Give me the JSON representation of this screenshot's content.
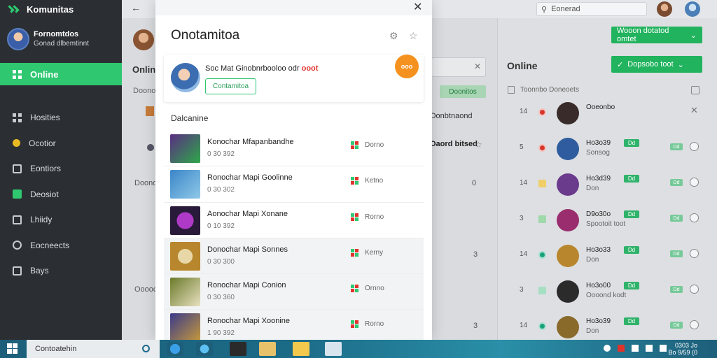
{
  "app": {
    "name": "Komunitas"
  },
  "profile": {
    "name": "Fornomtdos",
    "subtitle": "Gonad dlbemtinnt"
  },
  "nav": {
    "active": "Online",
    "items": [
      {
        "label": "Hosities",
        "icon": "grid-icon"
      },
      {
        "label": "Ocotior",
        "icon": "coin-icon"
      },
      {
        "label": "Eontiors",
        "icon": "puzzle-icon"
      },
      {
        "label": "Deosiot",
        "icon": "trophy-icon"
      },
      {
        "label": "Lhiidy",
        "icon": "card-icon"
      },
      {
        "label": "Eocneects",
        "icon": "connect-icon"
      },
      {
        "label": "Bays",
        "icon": "store-icon"
      }
    ]
  },
  "topbar": {
    "search_placeholder": "Eonerad"
  },
  "background_panel": {
    "title": "Onlin",
    "subhead": "Doonoo",
    "button": "Doonitos",
    "label1": "Oonbtnaond",
    "label2": "Oaord bitsed",
    "numbers": [
      "Doonod",
      "0",
      "Ooooc",
      "3",
      "3"
    ]
  },
  "right_panel": {
    "title": "Online",
    "button1": "Wooon dotatod omtet",
    "button2": "Dopsobo toot",
    "header": "Toonnbo Doneoets",
    "rows": [
      {
        "num": "14",
        "status": "red",
        "name": "Ooeonbo",
        "sub": "",
        "badge": "",
        "pill": "",
        "thumb": "#3a2b2b",
        "end": "x"
      },
      {
        "num": "5",
        "status": "red",
        "name": "Ho3o39",
        "sub": "Sonsog",
        "badge": "Dd",
        "pill": "Dd",
        "thumb": "#2e5c9e",
        "end": "radio"
      },
      {
        "num": "14",
        "status": "yellow",
        "name": "Ho3d39",
        "sub": "Don",
        "badge": "Dd",
        "pill": "Dd",
        "thumb": "#6a3a8c",
        "end": "radio"
      },
      {
        "num": "3",
        "status": "lgreen",
        "name": "D9o30o",
        "sub": "Spootoit toot",
        "badge": "Dd",
        "pill": "Dd",
        "thumb": "#9a2d6e",
        "end": "radio"
      },
      {
        "num": "14",
        "status": "teal",
        "name": "Ho3o33",
        "sub": "Don",
        "badge": "Dd",
        "pill": "Dd",
        "thumb": "#b8862c",
        "end": "radio"
      },
      {
        "num": "3",
        "status": "mint",
        "name": "Ho3o00",
        "sub": "Oooond kodt",
        "badge": "Dd",
        "pill": "Dd",
        "thumb": "#2b2b2b",
        "end": "radio"
      },
      {
        "num": "14",
        "status": "teal",
        "name": "Ho3o39",
        "sub": "Don",
        "badge": "Dd",
        "pill": "Dd",
        "thumb": "#8a6a2a",
        "end": "radio"
      }
    ]
  },
  "modal": {
    "title": "Onotamitoa",
    "profile_text": "Soc Mat Ginobnrbooloo odr",
    "profile_highlight": "ooot",
    "profile_button": "Contamitoa",
    "orange_badge": "ooo",
    "section_label": "Dalcanine",
    "games": [
      {
        "title": "Konochar Mfapanbandhe",
        "meta": "0 30 392",
        "status": "Dorno",
        "c1": "#5a2d82",
        "c2": "#2ea84a"
      },
      {
        "title": "Ronochar Mapi Goolinne",
        "meta": "0 30 302",
        "status": "Ketno",
        "c1": "#3b86c8",
        "c2": "#8fc8e8"
      },
      {
        "title": "Aonochar Mapi Xonane",
        "meta": "0 10 392",
        "status": "Rorno",
        "c1": "#2a1a3a",
        "c2": "#b03ac8"
      },
      {
        "title": "Donochar Mapi Sonnes",
        "meta": "0 30 300",
        "status": "Kerny",
        "c1": "#b8862c",
        "c2": "#e8d8a8"
      },
      {
        "title": "Ronochar Mapi Conion",
        "meta": "0 30 360",
        "status": "Ornno",
        "c1": "#6a7a2a",
        "c2": "#e8e0c0"
      },
      {
        "title": "Ronochar Mapi Xoonine",
        "meta": "1 90 392",
        "status": "Rorno",
        "c1": "#3a3a8a",
        "c2": "#c89a3a"
      }
    ]
  },
  "taskbar": {
    "search_text": "Contoatehin",
    "time": "0303 Jo",
    "date": "Bo 9/59 (0"
  }
}
